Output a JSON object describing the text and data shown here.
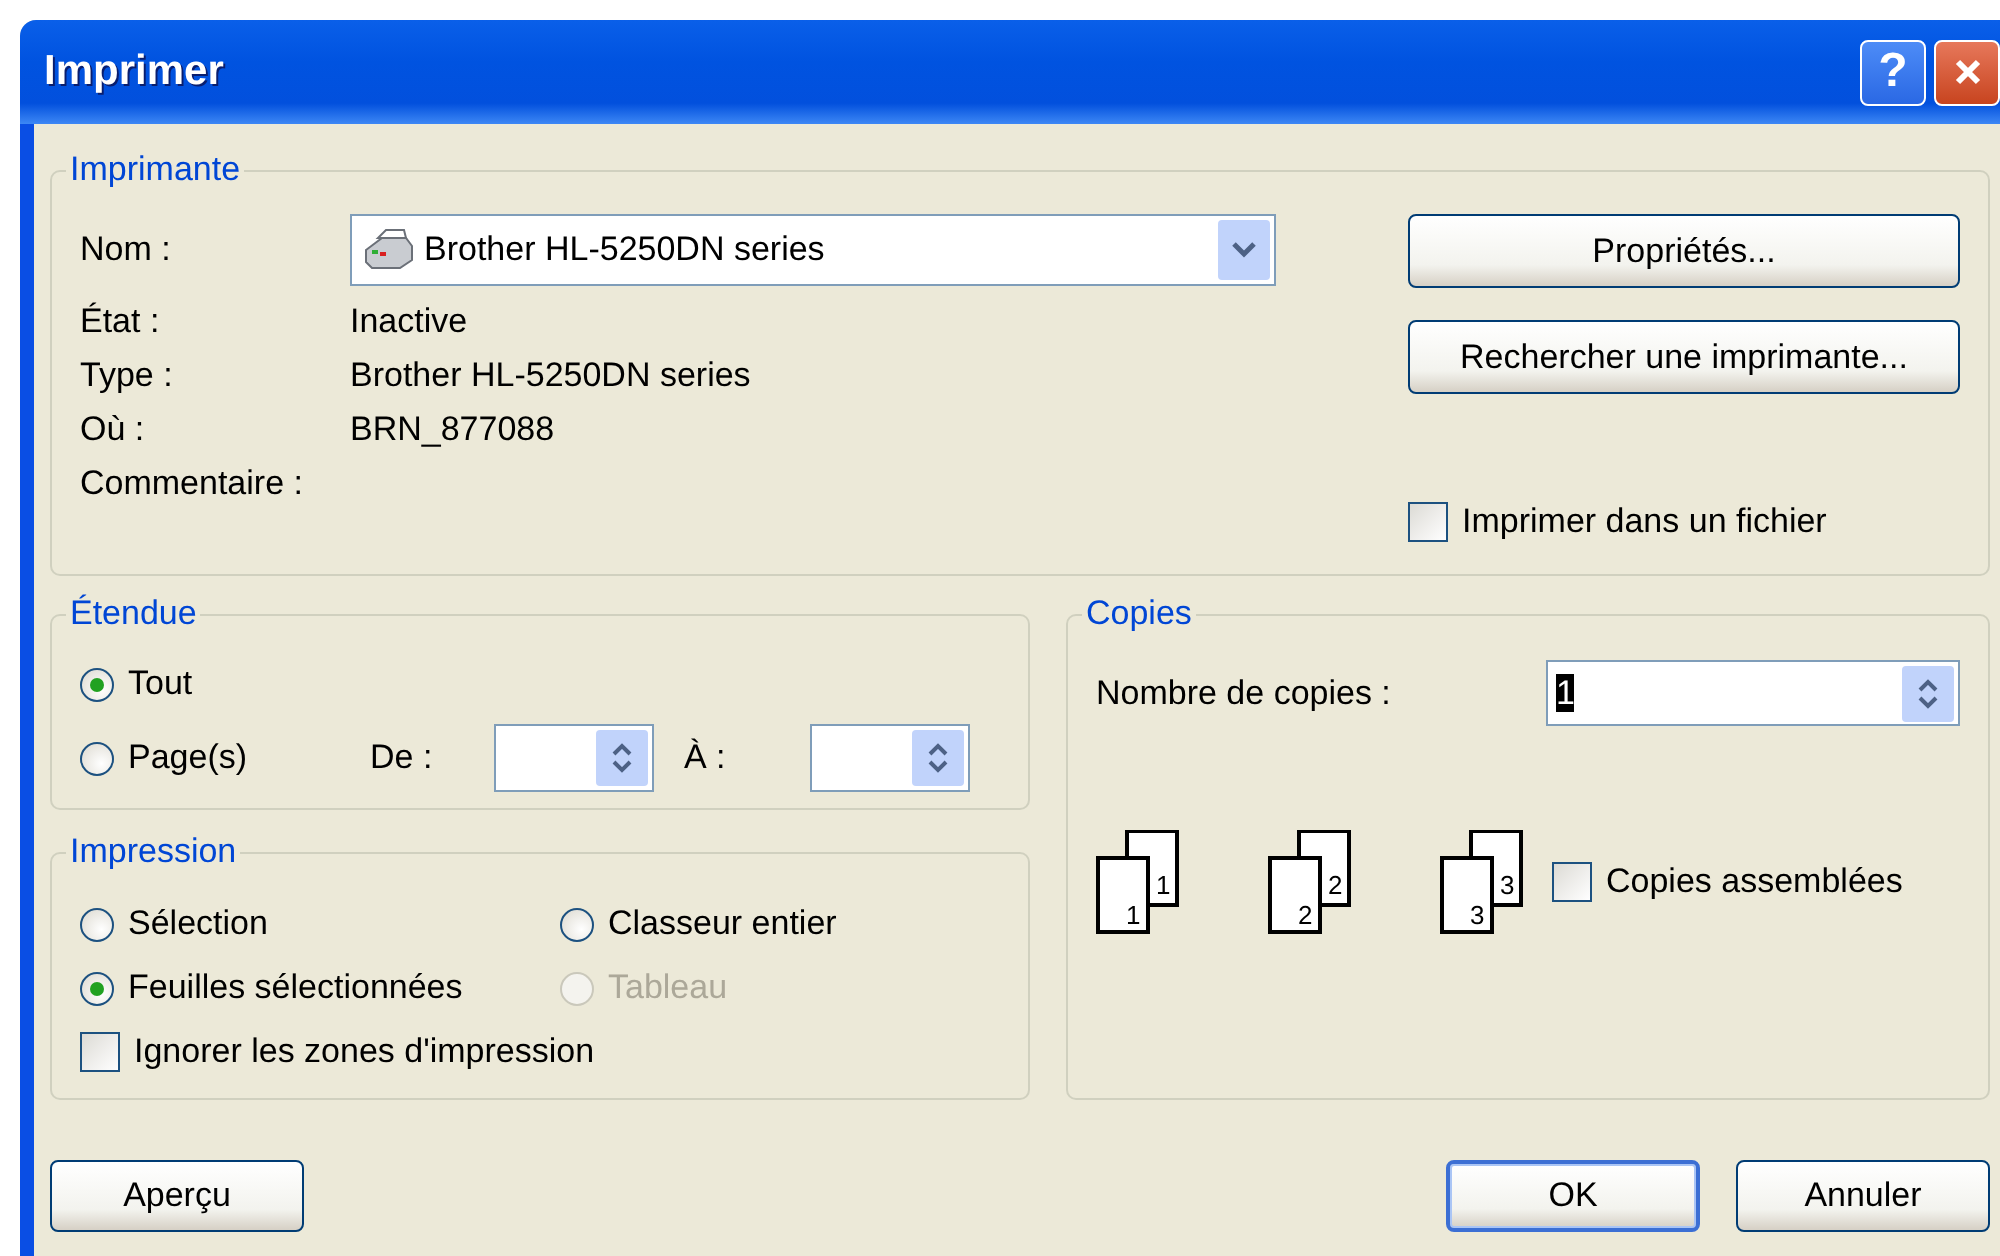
{
  "window": {
    "title": "Imprimer",
    "help_label": "?"
  },
  "printer": {
    "legend": "Imprimante",
    "name_label": "Nom :",
    "name_value": "Brother HL-5250DN series",
    "info": [
      {
        "label": "État :",
        "value": "Inactive"
      },
      {
        "label": "Type :",
        "value": "Brother HL-5250DN series"
      },
      {
        "label": "Où :",
        "value": "BRN_877088"
      },
      {
        "label": "Commentaire :"
      }
    ],
    "buttons": [
      "Propriétés...",
      "Rechercher une imprimante..."
    ],
    "print_to_file": {
      "label": "Imprimer dans un fichier",
      "checked": false
    }
  },
  "range": {
    "legend": "Étendue",
    "options": [
      {
        "label": "Tout",
        "selected": true
      },
      {
        "label": "Page(s)",
        "selected": false
      }
    ],
    "from_label": "De :",
    "to_label": "À :"
  },
  "print_what": {
    "legend": "Impression",
    "options": [
      {
        "label": "Sélection",
        "selected": false,
        "disabled": false
      },
      {
        "label": "Classeur entier",
        "selected": false,
        "disabled": false
      },
      {
        "label": "Feuilles sélectionnées",
        "selected": true,
        "disabled": false
      },
      {
        "label": "Tableau",
        "selected": false,
        "disabled": true
      }
    ],
    "ignore_print_areas": {
      "label": "Ignorer les zones d'impression",
      "checked": false
    }
  },
  "copies": {
    "legend": "Copies",
    "count_label": "Nombre de copies :",
    "count": {
      "value": "1",
      "highlighted": true
    },
    "stacks": [
      {
        "back": "1",
        "front": "1"
      },
      {
        "back": "2",
        "front": "2"
      },
      {
        "back": "3",
        "front": "3"
      }
    ],
    "collate": {
      "label": "Copies assemblées",
      "checked": false
    }
  },
  "footer": {
    "preview": "Aperçu",
    "actions": [
      {
        "label": "OK",
        "default": true
      },
      {
        "label": "Annuler",
        "default": false
      }
    ]
  }
}
